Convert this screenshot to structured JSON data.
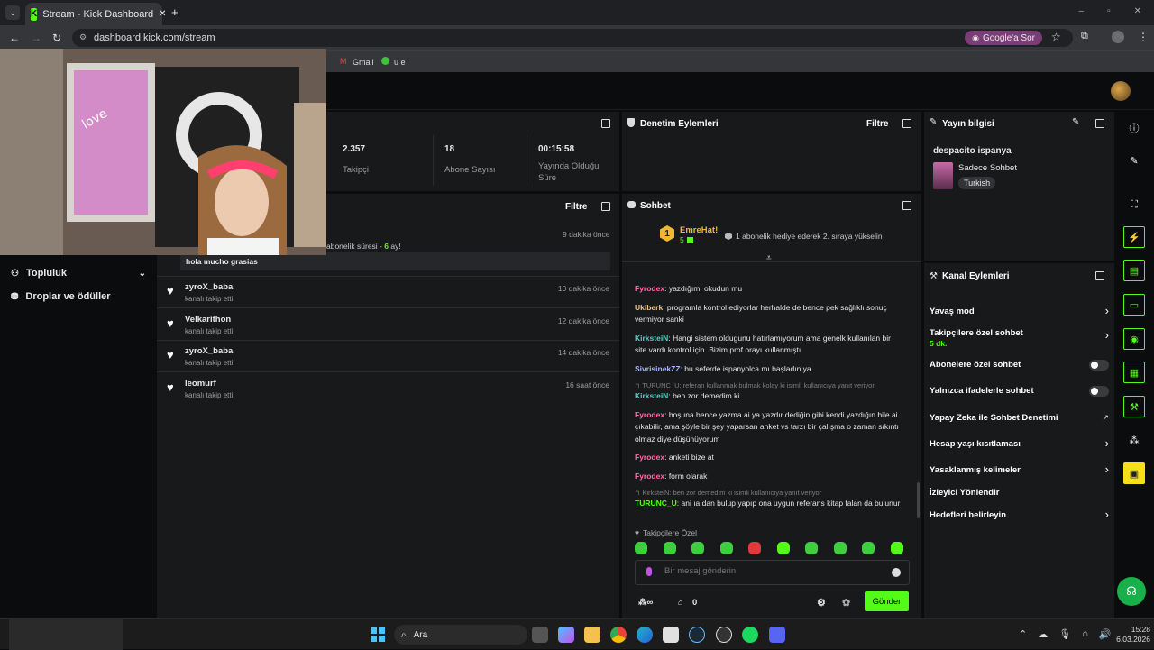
{
  "browser": {
    "tab_title": "Stream - Kick Dashboard",
    "url": "dashboard.kick.com/stream",
    "ask_google": "Google'a Sor",
    "bookmarks": [
      "Gmail",
      "u e"
    ]
  },
  "stats": {
    "followers_value": "2.357",
    "followers_label": "Takipçi",
    "subs_value": "18",
    "subs_label": "Abone Sayısı",
    "uptime_value": "00:15:58",
    "uptime_label": "Yayında Olduğu Süre"
  },
  "moderation": {
    "title": "Denetim Eylemleri",
    "filter": "Filtre"
  },
  "stream_info": {
    "title": "Yayın bilgisi",
    "stream_title": "despacito ispanya",
    "category": "Sadece Sohbet",
    "language": "Turkish"
  },
  "activity": {
    "filter": "Filtre",
    "top_time": "9 dakika önce",
    "sub_text": "abonelik süresi - ",
    "sub_months": "6",
    "sub_suffix": " ay!",
    "message": "hola mucho grasias",
    "items": [
      {
        "user": "zyroX_baba",
        "action": "kanalı takip etti",
        "time": "10 dakika önce"
      },
      {
        "user": "Velkarithon",
        "action": "kanalı takip etti",
        "time": "12 dakika önce"
      },
      {
        "user": "zyroX_baba",
        "action": "kanalı takip etti",
        "time": "14 dakika önce"
      },
      {
        "user": "leomurf",
        "action": "kanalı takip etti",
        "time": "16 saat önce"
      }
    ]
  },
  "sidebar": {
    "community": "Topluluk",
    "drops": "Droplar ve ödüller"
  },
  "chat": {
    "title": "Sohbet",
    "pinned_user": "EmreHat!",
    "pinned_rank": "1",
    "pinned_count": "5",
    "pinned_text": "1 abonelik hediye ederek 2. sıraya yükselin",
    "messages": [
      {
        "user": "Fyrodex",
        "color": "#ff6aa6",
        "text": "yazdığımı okudun mu"
      },
      {
        "user": "Ukiberk",
        "color": "#f5c27a",
        "text": "programla kontrol ediyorlar herhalde de bence pek sağlıklı sonuç vermiyor sanki"
      },
      {
        "user": "KirksteiN",
        "color": "#4fd1c5",
        "text": "Hangi sistem oldugunu hatırlamıyorum ama genelk kullanılan bir site vardı kontrol için. Bizim prof orayı kullanmıştı"
      },
      {
        "user": "SivrisinekZZ",
        "color": "#a8b4ff",
        "text": "bu seferde ispanyolca mı başladın ya"
      },
      {
        "user": "KirksteiN",
        "color": "#4fd1c5",
        "text": "ben zor demedim ki",
        "reply": "TURUNC_U: referan kullanmak bulmak kolay ki isimli kullanıcıya yanıt veriyor"
      },
      {
        "user": "Fyrodex",
        "color": "#ff6aa6",
        "text": "boşuna bence yazma ai ya yazdır dediğin gibi kendi yazdığın bile ai çıkabilir, ama şöyle bir şey yaparsan anket vs tarzı bir çalışma o zaman sıkıntı olmaz diye düşünüyorum"
      },
      {
        "user": "Fyrodex",
        "color": "#ff6aa6",
        "text": "anketi bize at"
      },
      {
        "user": "Fyrodex",
        "color": "#ff6aa6",
        "text": "form olarak"
      },
      {
        "user": "TURUNC_U",
        "color": "#53fc18",
        "text": "ani ıa dan bulup yapıp ona uygun referans kitap falan da bulunur",
        "reply": "KirksteiN: ben zor demedim ki isimli kullanıcıya yanıt veriyor"
      }
    ],
    "followers_only": "Takipçilere Özel",
    "placeholder": "Bir mesaj gönderin",
    "points": "0",
    "send": "Gönder"
  },
  "channel_actions": {
    "title": "Kanal Eylemleri",
    "items": [
      {
        "label": "Yavaş mod",
        "kind": "chevron"
      },
      {
        "label": "Takipçilere özel sohbet",
        "sub": "5 dk.",
        "kind": "chevron"
      },
      {
        "label": "Abonelere özel sohbet",
        "kind": "toggle"
      },
      {
        "label": "Yalnızca ifadelerle sohbet",
        "kind": "toggle"
      },
      {
        "label": "Yapay Zeka ile Sohbet Denetimi",
        "kind": "external"
      },
      {
        "label": "Hesap yaşı kısıtlaması",
        "kind": "chevron"
      },
      {
        "label": "Yasaklanmış kelimeler",
        "kind": "chevron"
      },
      {
        "label": "İzleyici Yönlendir",
        "kind": "none"
      },
      {
        "label": "Hedefleri belirleyin",
        "kind": "chevron"
      }
    ]
  },
  "taskbar": {
    "search": "Ara",
    "time": "15:28",
    "date": "6.03.2026"
  }
}
